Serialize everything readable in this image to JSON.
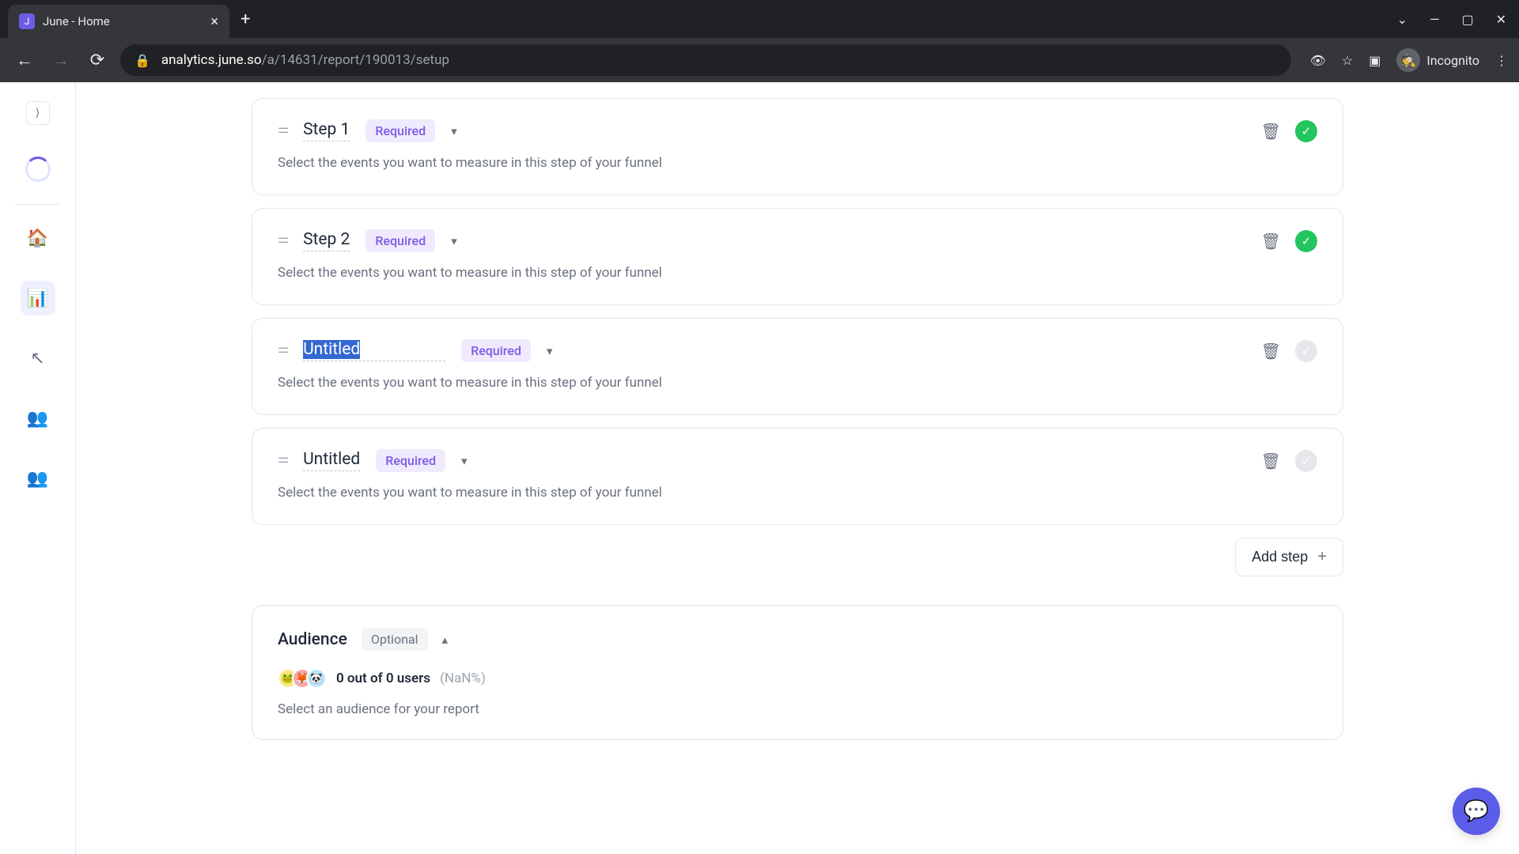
{
  "browser": {
    "tab_title": "June - Home",
    "url_host": "analytics.june.so",
    "url_path": "/a/14631/report/190013/setup",
    "incognito_label": "Incognito"
  },
  "steps": [
    {
      "name": "Step 1",
      "required": "Required",
      "desc": "Select the events you want to measure in this step of your funnel",
      "complete": true,
      "editing": false
    },
    {
      "name": "Step 2",
      "required": "Required",
      "desc": "Select the events you want to measure in this step of your funnel",
      "complete": true,
      "editing": false
    },
    {
      "name": "Untitled",
      "required": "Required",
      "desc": "Select the events you want to measure in this step of your funnel",
      "complete": false,
      "editing": true
    },
    {
      "name": "Untitled",
      "required": "Required",
      "desc": "Select the events you want to measure in this step of your funnel",
      "complete": false,
      "editing": false
    }
  ],
  "add_step_label": "Add step",
  "audience": {
    "title": "Audience",
    "badge": "Optional",
    "count_text": "0 out of 0 users",
    "pct_text": "(NaN%)",
    "desc": "Select an audience for your report"
  }
}
